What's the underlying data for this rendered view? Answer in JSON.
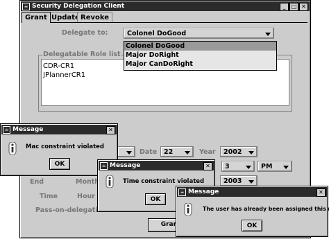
{
  "main_window": {
    "title": "Security Delegation Client",
    "tabs": [
      {
        "label": "Grant"
      },
      {
        "label": "Update"
      },
      {
        "label": "Revoke"
      }
    ],
    "delegate_to_label": "Delegate to:",
    "delegate_to_value": "Colonel DoGood",
    "delegate_options": [
      "Colonel DoGood",
      "Major DoRight",
      "Major CanDoRight"
    ],
    "role_list_label": "Delegatable Role list",
    "roles": [
      "CDR-CR1",
      "JPlannerCR1"
    ],
    "date_label": "Date",
    "date_value": "22",
    "year_label": "Year",
    "year_value": "2002",
    "hour_value": "3",
    "ampm_value": "PM",
    "end_label": "End",
    "month_label": "Month",
    "end_year_value": "2003",
    "time_label": "Time",
    "hour_label": "Hour",
    "pass_on_label": "Pass-on-delegation",
    "grant_button": "Grant"
  },
  "dialogs": [
    {
      "title": "Message",
      "message": "Mac constraint violated",
      "ok": "OK"
    },
    {
      "title": "Message",
      "message": "Time constraint violated",
      "ok": "OK"
    },
    {
      "title": "Message",
      "message": "The user has already been assigned this role",
      "ok": "OK"
    }
  ],
  "icons": {
    "window_icon": "java-cup-icon",
    "minimize": "minimize-icon",
    "maximize": "maximize-icon",
    "close": "close-icon",
    "info": "info-icon"
  }
}
